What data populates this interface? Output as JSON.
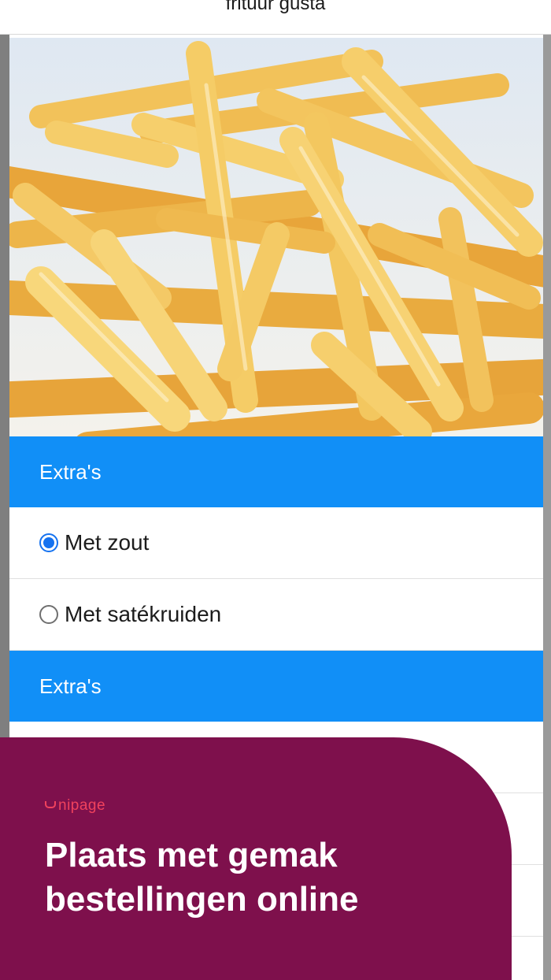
{
  "header": {
    "title": "frituur gusta"
  },
  "product": {
    "image": "french-fries-photo"
  },
  "sections": [
    {
      "title": "Extra's",
      "options": [
        {
          "label": "Met zout",
          "selected": true
        },
        {
          "label": "Met satékruiden",
          "selected": false
        }
      ]
    },
    {
      "title": "Extra's"
    }
  ],
  "promo": {
    "brand": "nipage",
    "headline": "Plaats met gemak bestellingen online",
    "background": "#7e104c",
    "brand_color": "#f0425d"
  },
  "colors": {
    "accent": "#118ff7",
    "radio": "#1572f0"
  }
}
